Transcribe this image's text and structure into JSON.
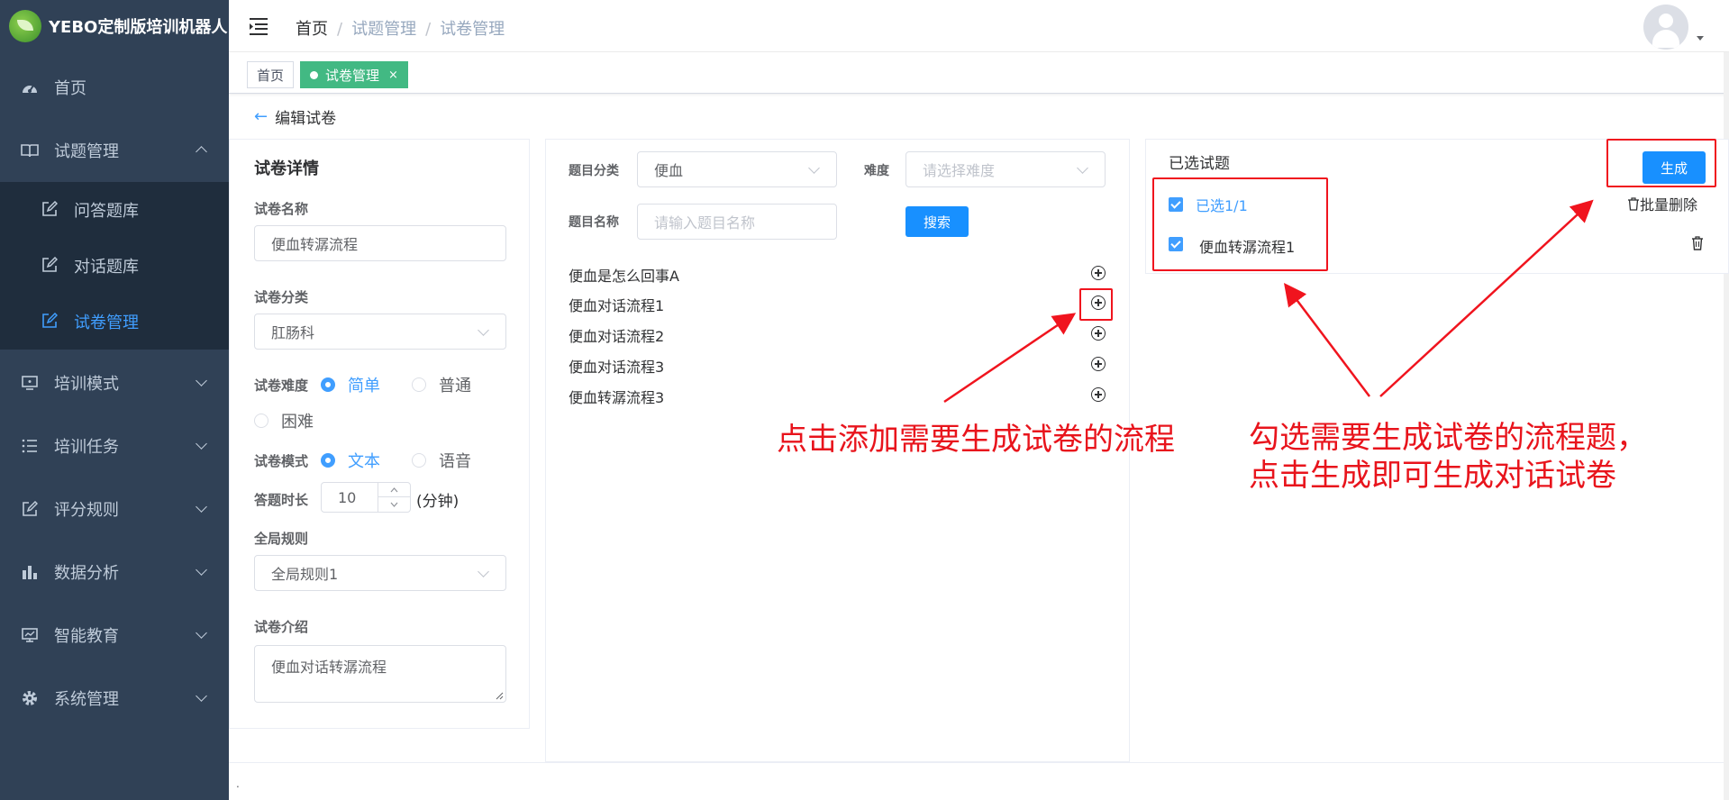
{
  "app": {
    "title": "YEBO定制版培训机器人"
  },
  "sidebar": {
    "items": [
      {
        "label": "首页",
        "icon": "dashboard-icon"
      },
      {
        "label": "试题管理",
        "icon": "book-icon",
        "expanded": true,
        "children": [
          {
            "label": "问答题库",
            "icon": "edit-icon"
          },
          {
            "label": "对话题库",
            "icon": "edit-icon"
          },
          {
            "label": "试卷管理",
            "icon": "edit-icon",
            "active": true
          }
        ]
      },
      {
        "label": "培训模式",
        "icon": "monitor-icon"
      },
      {
        "label": "培训任务",
        "icon": "list-icon"
      },
      {
        "label": "评分规则",
        "icon": "edit-icon"
      },
      {
        "label": "数据分析",
        "icon": "bar-chart-icon"
      },
      {
        "label": "智能教育",
        "icon": "screen-icon"
      },
      {
        "label": "系统管理",
        "icon": "gear-icon"
      }
    ]
  },
  "breadcrumb": [
    "首页",
    "试题管理",
    "试卷管理"
  ],
  "tags": [
    {
      "label": "首页"
    },
    {
      "label": "试卷管理",
      "close": "×"
    }
  ],
  "page": {
    "back_label": "编辑试卷"
  },
  "details": {
    "title": "试卷详情",
    "name_label": "试卷名称",
    "name_value": "便血转潺流程",
    "category_label": "试卷分类",
    "category_value": "肛肠科",
    "difficulty_label": "试卷难度",
    "difficulty_options": [
      "简单",
      "普通",
      "困难"
    ],
    "difficulty_selected": "简单",
    "mode_label": "试卷模式",
    "mode_options": [
      "文本",
      "语音"
    ],
    "mode_selected": "文本",
    "duration_label": "答题时长",
    "duration_value": "10",
    "duration_unit": "(分钟)",
    "rule_label": "全局规则",
    "rule_value": "全局规则1",
    "intro_label": "试卷介绍",
    "intro_value": "便血对话转潺流程"
  },
  "search": {
    "category_label": "题目分类",
    "category_value": "便血",
    "difficulty_label": "难度",
    "difficulty_placeholder": "请选择难度",
    "name_label": "题目名称",
    "name_placeholder": "请输入题目名称",
    "search_button": "搜索"
  },
  "questions": [
    "便血是怎么回事A",
    "便血对话流程1",
    "便血对话流程2",
    "便血对话流程3",
    "便血转潺流程3"
  ],
  "selected": {
    "title": "已选试题",
    "generate_button": "生成",
    "batch_delete": "批量删除",
    "count_label": "已选1/1",
    "items": [
      "便血转潺流程1"
    ]
  },
  "annotations": {
    "left_note": "点击添加需要生成试卷的流程",
    "right_note_line1": "勾选需要生成试卷的流程题，",
    "right_note_line2": "点击生成即可生成对话试卷",
    "color": "#e8141c"
  },
  "colors": {
    "sidebar": "#304156",
    "primary": "#1890ff",
    "active_tag": "#42b983",
    "annotation": "#f0141e"
  },
  "footer": {
    "text": "."
  }
}
